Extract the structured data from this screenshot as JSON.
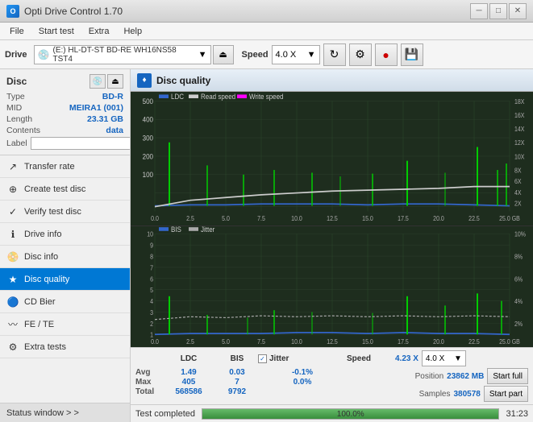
{
  "window": {
    "title": "Opti Drive Control 1.70",
    "minimize": "─",
    "maximize": "□",
    "close": "✕"
  },
  "menu": {
    "items": [
      "File",
      "Start test",
      "Extra",
      "Help"
    ]
  },
  "toolbar": {
    "drive_label": "Drive",
    "drive_value": "(E:)  HL-DT-ST BD-RE  WH16NS58 TST4",
    "speed_label": "Speed",
    "speed_value": "4.0 X",
    "eject_icon": "⏏"
  },
  "sidebar": {
    "disc_title": "Disc",
    "disc_type_label": "Type",
    "disc_type_value": "BD-R",
    "mid_label": "MID",
    "mid_value": "MEIRA1 (001)",
    "length_label": "Length",
    "length_value": "23.31 GB",
    "contents_label": "Contents",
    "contents_value": "data",
    "label_label": "Label",
    "label_value": "",
    "nav_items": [
      {
        "id": "transfer-rate",
        "label": "Transfer rate",
        "icon": "↗"
      },
      {
        "id": "create-test-disc",
        "label": "Create test disc",
        "icon": "⊕"
      },
      {
        "id": "verify-test-disc",
        "label": "Verify test disc",
        "icon": "✓"
      },
      {
        "id": "drive-info",
        "label": "Drive info",
        "icon": "ℹ"
      },
      {
        "id": "disc-info",
        "label": "Disc info",
        "icon": "📀"
      },
      {
        "id": "disc-quality",
        "label": "Disc quality",
        "icon": "★",
        "active": true
      },
      {
        "id": "cd-bier",
        "label": "CD Bier",
        "icon": "🔵"
      },
      {
        "id": "fe-te",
        "label": "FE / TE",
        "icon": "〰"
      },
      {
        "id": "extra-tests",
        "label": "Extra tests",
        "icon": "⚙"
      }
    ],
    "status_window": "Status window > >"
  },
  "disc_quality": {
    "title": "Disc quality",
    "legend": {
      "ldc": "LDC",
      "read_speed": "Read speed",
      "write_speed": "Write speed"
    },
    "legend2": {
      "bis": "BIS",
      "jitter": "Jitter"
    },
    "chart1": {
      "y_max": 500,
      "x_max": 25,
      "right_labels": [
        "18X",
        "16X",
        "14X",
        "12X",
        "10X",
        "8X",
        "6X",
        "4X",
        "2X"
      ],
      "x_labels": [
        "0.0",
        "2.5",
        "5.0",
        "7.5",
        "10.0",
        "12.5",
        "15.0",
        "17.5",
        "20.0",
        "22.5",
        "25.0 GB"
      ]
    },
    "chart2": {
      "y_max": 10,
      "x_max": 25,
      "right_labels": [
        "10%",
        "8%",
        "6%",
        "4%",
        "2%"
      ],
      "x_labels": [
        "0.0",
        "2.5",
        "5.0",
        "7.5",
        "10.0",
        "12.5",
        "15.0",
        "17.5",
        "20.0",
        "22.5",
        "25.0 GB"
      ]
    }
  },
  "stats": {
    "columns": [
      "",
      "LDC",
      "BIS",
      "",
      "Jitter",
      "Speed"
    ],
    "avg_label": "Avg",
    "max_label": "Max",
    "total_label": "Total",
    "avg_ldc": "1.49",
    "avg_bis": "0.03",
    "avg_jitter": "-0.1%",
    "max_ldc": "405",
    "max_bis": "7",
    "max_jitter": "0.0%",
    "total_ldc": "568586",
    "total_bis": "9792",
    "jitter_checked": true,
    "jitter_label": "Jitter",
    "speed_label": "Speed",
    "speed_value": "4.23 X",
    "speed_dropdown": "4.0 X",
    "position_label": "Position",
    "position_value": "23862 MB",
    "samples_label": "Samples",
    "samples_value": "380578",
    "start_full": "Start full",
    "start_part": "Start part"
  },
  "bottom": {
    "status_text": "Test completed",
    "progress_pct": 100,
    "progress_label": "100.0%",
    "time_text": "31:23"
  },
  "colors": {
    "accent": "#1565C0",
    "active_nav": "#0078d4",
    "ldc_color": "#3366cc",
    "read_speed_color": "#cccccc",
    "write_speed_color": "#ff00ff",
    "bis_color": "#3366cc",
    "jitter_color": "#ffff00",
    "spike_color": "#00ff00",
    "progress_color": "#66bb6a"
  }
}
